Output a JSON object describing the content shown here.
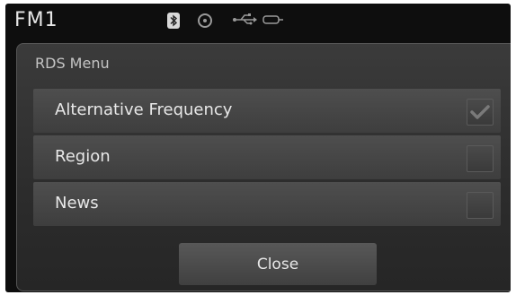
{
  "status_bar": {
    "source": "FM1",
    "icons": [
      "bluetooth-icon",
      "disc-icon",
      "usb-icon",
      "aux-icon"
    ]
  },
  "rds_menu": {
    "title": "RDS Menu",
    "items": [
      {
        "label": "Alternative Frequency",
        "checked": true
      },
      {
        "label": "Region",
        "checked": false
      },
      {
        "label": "News",
        "checked": false
      }
    ],
    "close_label": "Close"
  }
}
